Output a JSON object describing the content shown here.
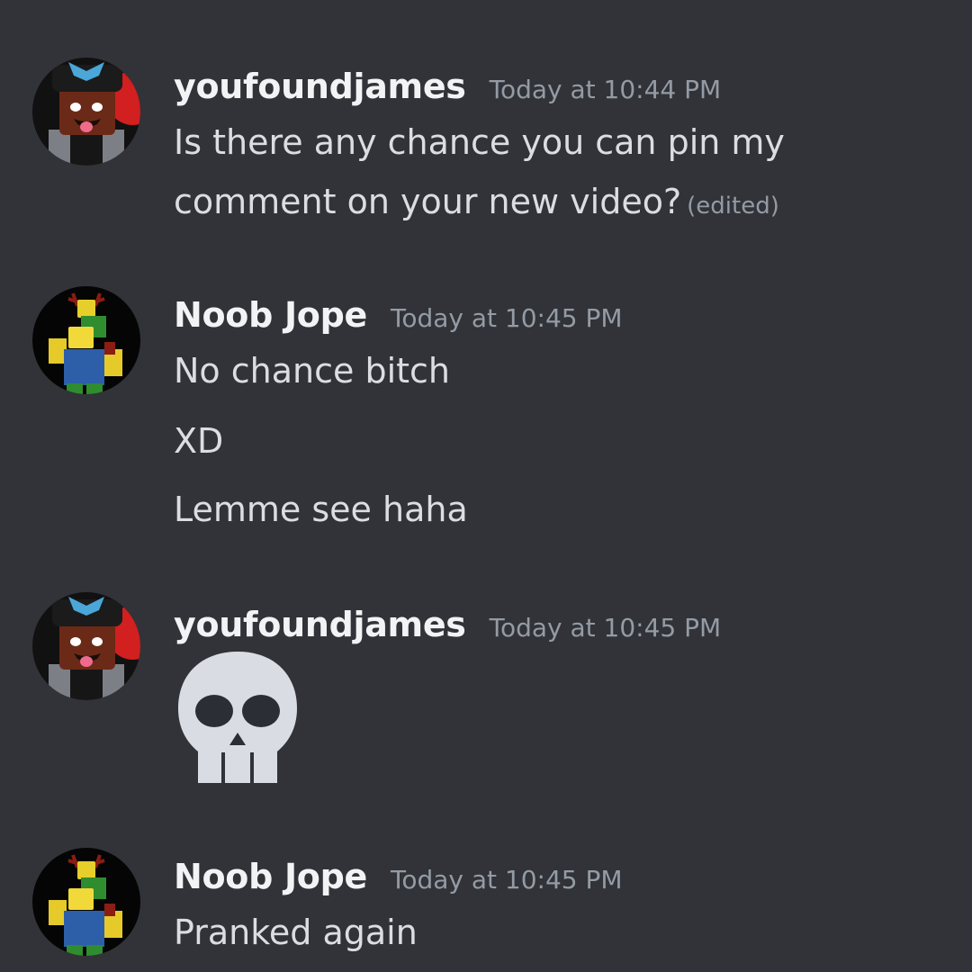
{
  "colors": {
    "background": "#313338",
    "username": "#f2f3f5",
    "message_text": "#dbdee1",
    "timestamp": "#949ba4"
  },
  "messages": [
    {
      "author": "youfoundjames",
      "timestamp": "Today at 10:44 PM",
      "lines": [
        "Is there any chance you can pin my",
        "comment on your new video?"
      ],
      "edited_label": "(edited)",
      "avatar": "youfoundjames-avatar"
    },
    {
      "author": "Noob Jope",
      "timestamp": "Today at 10:45 PM",
      "lines": [
        "No chance bitch",
        "XD",
        "Lemme see haha"
      ],
      "avatar": "noob-jope-avatar"
    },
    {
      "author": "youfoundjames",
      "timestamp": "Today at 10:45 PM",
      "emoji": "skull-emoji",
      "avatar": "youfoundjames-avatar"
    },
    {
      "author": "Noob Jope",
      "timestamp": "Today at 10:45 PM",
      "lines": [
        "Pranked again"
      ],
      "avatar": "noob-jope-avatar"
    }
  ]
}
